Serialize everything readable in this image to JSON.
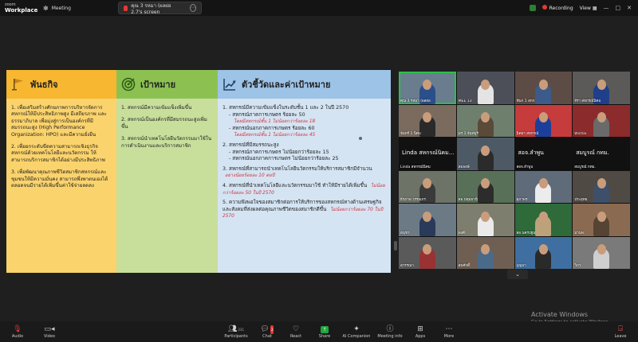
{
  "app": {
    "brand_top": "zoom",
    "brand_bottom": "Workplace",
    "meeting_tab": "Meeting",
    "share_tab": "คุณ 3 รหมา (ผลผ่อ 2.7's screen",
    "recording": "Recording",
    "view": "View"
  },
  "slide": {
    "col1": {
      "title": "พันธกิจ",
      "items": [
        "1. เพื่อเสริมสร้างศักยภาพการบริหารจัดการสหกรณ์ให้มีประสิทธิภาพสูง มีเสถียรภาพ และธรรมาภิบาล เพื่อมุ่งสู่การเป็นองค์กรที่มีสมรรถนะสูง (High Performance Organization: HPO) และมีความยั่งยืน",
        "2. เพื่อยกระดับขีดความสามารถเชิงธุรกิจสหกรณ์ด้วยเทคโนโลยีและนวัตกรรม ให้สามารถบริการสมาชิกได้อย่างมีประสิทธิภาพ",
        "3. เพื่อพัฒนาคุณภาพชีวิตสมาชิกสหกรณ์และชุมชนให้มีความมั่นคง สามารถพึ่งพาตนเองได้ตลอดจนมีรายได้เพิ่มขึ้นค่าใช้จ่ายลดลง"
      ]
    },
    "col2": {
      "title": "เป้าหมาย",
      "items": [
        "1. สหกรณ์มีความเข้มแข็งเพิ่มขึ้น",
        "2. สหกรณ์เป็นองค์กรที่มีสมรรถนะสูงเพิ่มขึ้น",
        "3. สหกรณ์นำเทคโนโลยีนวัตกรรมมาใช้ในการดำเนินงานและบริการสมาชิก"
      ]
    },
    "col3": {
      "title": "ตัวชี้วัดและค่าเป้าหมาย",
      "i1": "1. สหกรณ์มีความเข้มแข็งในระดับชั้น 1 และ 2 ในปี 2570",
      "i1a": "- สหกรณ์ภาคการเกษตร ร้อยละ 50",
      "i1a_t": "โดยมีสหกรณ์ชั้น 1 ไม่น้อยกว่าร้อยละ 18",
      "i1b": "- สหกรณ์นอกภาคการเกษตร ร้อยละ 60",
      "i1b_t": "โดยมีสหกรณ์ชั้น 1 ไม่น้อยกว่าร้อยละ 45",
      "i2": "2. สหกรณ์ที่มีสมรรถนะสูง",
      "i2a": "- สหกรณ์ภาคการเกษตร ไม่น้อยกว่าร้อยละ 15",
      "i2b": "- สหกรณ์นอกภาคการเกษตร ไม่น้อยกว่าร้อยละ 25",
      "i3": "3. สหกรณ์ที่สามารถนำเทคโนโลยีนวัตกรรมให้บริการสมาชิกมีจำนวน",
      "i3_t": "อย่างน้อยร้อยละ 10 ต่อปี",
      "i4": "4. สหกรณ์ที่นำเทคโนโลยีและนวัตกรรมมาใช้ ทำให้มีรายได้เพิ่มขึ้น",
      "i4_t": "ไม่น้อยกว่าร้อยละ 50 ในปี 2570",
      "i5": "5. ความพึงพอใจของสมาชิกต่อการให้บริการของสหกรณ์ทางด้านเศรษฐกิจ และสังคมที่ส่งผลต่อคุณภาพชีวิตของสมาชิกดีขึ้น",
      "i5_t": "ไม่น้อยกว่าร้อยละ 70 ในปี 2570"
    }
  },
  "gallery": [
    {
      "name": "คุณ 3 รหมา (ผลผ่อ",
      "bg": "#6a7d8f",
      "shirt": "#2b4f8a",
      "active": true,
      "dark": false
    },
    {
      "name": "MEE 13",
      "bg": "#4c4f57",
      "shirt": "#e4e4e4",
      "active": false,
      "dark": false
    },
    {
      "name": "ชันก 1 สกก",
      "bg": "#5d4c45",
      "shirt": "#3c5b8a",
      "active": false,
      "dark": false
    },
    {
      "name": "จีรา สหกรณ์นิคม",
      "bg": "#5b5a58",
      "shirt": "#1f3f8a",
      "active": false,
      "dark": false
    },
    {
      "name": "จันทร์ 1 นิคม",
      "bg": "#7a6b5e",
      "shirt": "#2a2a2a",
      "active": false,
      "dark": false
    },
    {
      "name": "พร 1 จันทบุรี",
      "bg": "#6e7f6d",
      "shirt": "#5a4a3a",
      "active": false,
      "dark": false
    },
    {
      "name": "นิตยา สหกรณ์",
      "bg": "#c63b3b",
      "shirt": "#1e3f99",
      "active": false,
      "dark": false
    },
    {
      "name": "Wichai",
      "bg": "#8b2b2b",
      "shirt": "#6a6a6a",
      "active": false,
      "dark": false
    },
    {
      "name": "Linda สหกรณ์นิคม",
      "big": "Linda สหกรณ์นิคม...",
      "bg": "#111",
      "shirt": "#111",
      "active": false,
      "dark": true
    },
    {
      "name": "สมพงษ์",
      "bg": "#4d5a66",
      "shirt": "#2b2b2b",
      "active": false,
      "dark": false
    },
    {
      "name": "สอจ.ลำพูน",
      "big": "สอจ.ลำพูน",
      "bg": "#111",
      "shirt": "#111",
      "active": false,
      "dark": true
    },
    {
      "name": "สมบูรณ์ กทม.",
      "big": "สมบูรณ์ กทม.",
      "bg": "#111",
      "shirt": "#111",
      "active": false,
      "dark": true
    },
    {
      "name": "ธีรภาพ วรรณกร",
      "bg": "#6e7368",
      "shirt": "#3a3a3a",
      "active": false,
      "dark": false
    },
    {
      "name": "สอ.ปทุมธานี",
      "bg": "#587058",
      "shirt": "#2c2c2c",
      "active": false,
      "dark": false
    },
    {
      "name": "สุภาพร",
      "bg": "#5f6b79",
      "shirt": "#ececec",
      "active": false,
      "dark": false
    },
    {
      "name": "ประยุทธ",
      "bg": "#4f4a44",
      "shirt": "#3d4f6a",
      "active": false,
      "dark": false
    },
    {
      "name": "อนุชา",
      "bg": "#6c7a85",
      "shirt": "#2a3a5a",
      "active": false,
      "dark": false
    },
    {
      "name": "พงศ์",
      "bg": "#7e7e6e",
      "shirt": "#eaeaea",
      "active": false,
      "dark": false
    },
    {
      "name": "สอ.นครปฐม",
      "bg": "#2f6a3a",
      "shirt": "#bca27a",
      "active": false,
      "dark": false
    },
    {
      "name": "มานพ",
      "bg": "#8a6b52",
      "shirt": "#554433",
      "active": false,
      "dark": false
    },
    {
      "name": "สุวรรณา",
      "bg": "#5a5a5a",
      "shirt": "#993333",
      "active": false,
      "dark": false
    },
    {
      "name": "สมศักดิ์",
      "bg": "#6f5f52",
      "shirt": "#4a6a8a",
      "active": false,
      "dark": false
    },
    {
      "name": "บุญมา",
      "bg": "#3e6fa0",
      "shirt": "#2a2a2a",
      "active": false,
      "dark": false
    },
    {
      "name": "วิภา",
      "bg": "#7a7a7a",
      "shirt": "#cfcfcf",
      "active": false,
      "dark": false
    }
  ],
  "gallery_scroll": "⌄",
  "activate": {
    "line1": "Activate Windows",
    "line2": "Go to Settings to activate Windows."
  },
  "toolbar": {
    "audio": "Audio",
    "video": "Video",
    "participants": "Participants",
    "participants_count": "231",
    "chat": "Chat",
    "chat_badge": "2",
    "react": "React",
    "share": "Share",
    "ai": "AI Companion",
    "info": "Meeting info",
    "apps": "Apps",
    "more": "More",
    "leave": "Leave"
  }
}
